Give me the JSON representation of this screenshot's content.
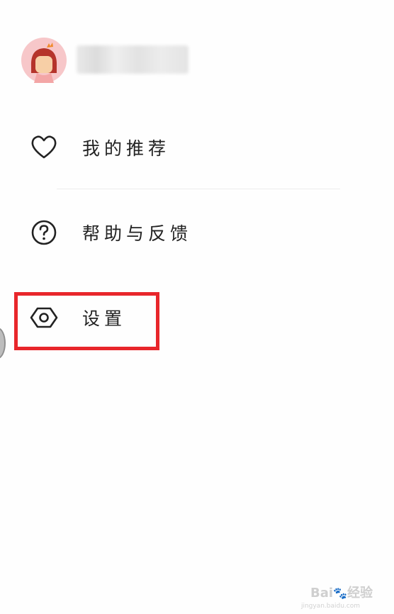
{
  "profile": {
    "avatar_icon": "avatar-girl-icon"
  },
  "menu": {
    "items": [
      {
        "label": "我的推荐",
        "icon": "heart-icon"
      },
      {
        "label": "帮助与反馈",
        "icon": "help-circle-icon"
      },
      {
        "label": "设置",
        "icon": "settings-hexagon-icon"
      }
    ]
  },
  "highlight": {
    "color": "#e8262b",
    "target": "设置"
  },
  "watermark": {
    "text": "Bai",
    "text2": "经验",
    "url": "jingyan.baidu.com"
  }
}
